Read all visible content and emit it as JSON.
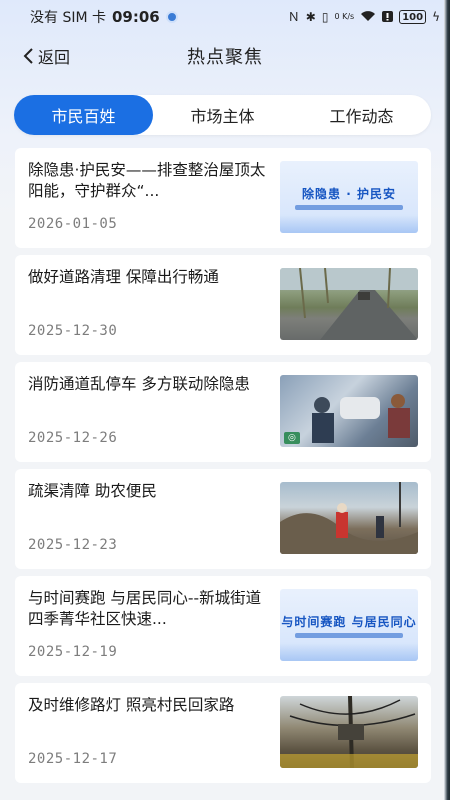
{
  "status_bar": {
    "carrier": "没有 SIM 卡",
    "time": "09:06",
    "network_speed": "0 K/s",
    "battery": "100"
  },
  "header": {
    "back_label": "返回",
    "title": "热点聚焦"
  },
  "tabs": [
    {
      "label": "市民百姓",
      "active": true
    },
    {
      "label": "市场主体",
      "active": false
    },
    {
      "label": "工作动态",
      "active": false
    }
  ],
  "news": [
    {
      "title": "除隐患·护民安——排查整治屋顶太阳能，守护群众“...",
      "date": "2026-01-05",
      "thumb_text": "除隐患 · 护民安"
    },
    {
      "title": "做好道路清理  保障出行畅通",
      "date": "2025-12-30",
      "thumb_text": ""
    },
    {
      "title": "消防通道乱停车  多方联动除隐患",
      "date": "2025-12-26",
      "thumb_text": ""
    },
    {
      "title": "疏渠清障  助农便民",
      "date": "2025-12-23",
      "thumb_text": ""
    },
    {
      "title": "与时间赛跑 与居民同心--新城街道四季菁华社区快速...",
      "date": "2025-12-19",
      "thumb_text": "与时间赛跑 与居民同心"
    },
    {
      "title": "及时维修路灯  照亮村民回家路",
      "date": "2025-12-17",
      "thumb_text": ""
    }
  ],
  "colors": {
    "accent": "#1b6fe3",
    "date": "#7d7d7d",
    "card": "#ffffff"
  }
}
